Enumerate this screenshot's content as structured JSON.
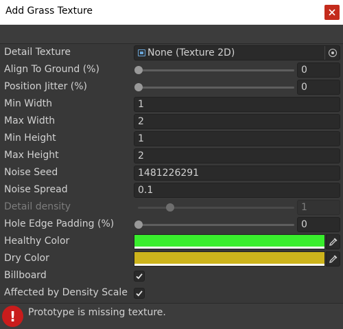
{
  "window": {
    "title": "Add Grass Texture"
  },
  "fields": {
    "detail_texture": {
      "label": "Detail Texture",
      "value": "None (Texture 2D)",
      "icon": "texture-icon"
    },
    "align_to_ground": {
      "label": "Align To Ground (%)",
      "value": "0",
      "slider_fraction": 0
    },
    "position_jitter": {
      "label": "Position Jitter (%)",
      "value": "0",
      "slider_fraction": 0
    },
    "min_width": {
      "label": "Min Width",
      "value": "1"
    },
    "max_width": {
      "label": "Max Width",
      "value": "2"
    },
    "min_height": {
      "label": "Min Height",
      "value": "1"
    },
    "max_height": {
      "label": "Max Height",
      "value": "2"
    },
    "noise_seed": {
      "label": "Noise Seed",
      "value": "1481226291"
    },
    "noise_spread": {
      "label": "Noise Spread",
      "value": "0.1"
    },
    "detail_density": {
      "label": "Detail density",
      "value": "1",
      "slider_fraction": 0.2,
      "disabled": true
    },
    "hole_edge_padding": {
      "label": "Hole Edge Padding (%)",
      "value": "0",
      "slider_fraction": 0
    },
    "healthy_color": {
      "label": "Healthy Color",
      "color": "#39ee2d"
    },
    "dry_color": {
      "label": "Dry Color",
      "color": "#cdb41c"
    },
    "billboard": {
      "label": "Billboard",
      "checked": true
    },
    "affected_by_density_scale": {
      "label": "Affected by Density Scale",
      "checked": true
    }
  },
  "help": {
    "message": "Prototype is missing texture.",
    "icon": "error-icon",
    "glyph": "!"
  },
  "colors": {
    "accent_error": "#c91c1c",
    "close_button": "#c42b1c",
    "background": "#383838"
  }
}
